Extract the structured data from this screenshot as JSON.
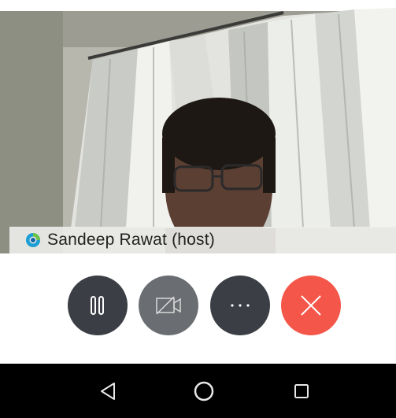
{
  "participant": {
    "name": "Sandeep Rawat (host)"
  },
  "controls": {
    "pause_icon": "pause-icon",
    "video_icon": "video-off-icon",
    "more_icon": "more-icon",
    "end_icon": "close-icon"
  },
  "navigation": {
    "back_icon": "back-triangle-icon",
    "home_icon": "home-circle-icon",
    "recents_icon": "recents-square-icon"
  },
  "colors": {
    "end_call": "#f4574a",
    "control_dark": "#3b3f45",
    "control_muted": "#6a6d71",
    "nav_background": "#000000"
  }
}
